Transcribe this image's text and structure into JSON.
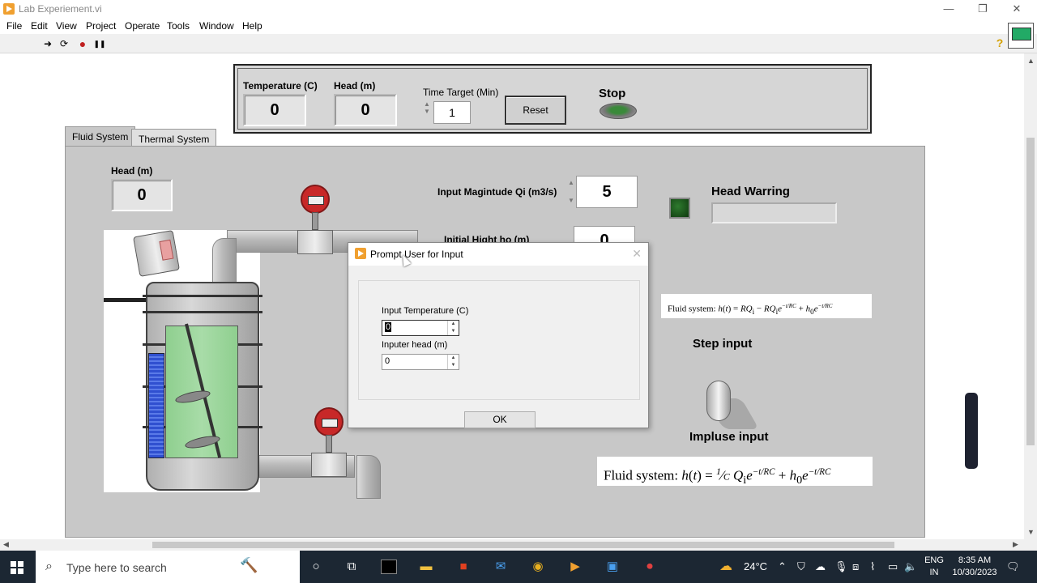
{
  "window": {
    "title": "Lab Experiement.vi",
    "controls": {
      "minimize": "—",
      "restore": "❐",
      "close": "✕"
    }
  },
  "menu": [
    "File",
    "Edit",
    "View",
    "Project",
    "Operate",
    "Tools",
    "Window",
    "Help"
  ],
  "toolbar": {
    "run": "➜",
    "run_continuous": "⟳",
    "abort": "●",
    "pause": "❚❚",
    "help": "?"
  },
  "controls": {
    "temperature_label": "Temperature (C)",
    "temperature_value": "0",
    "head_label": "Head (m)",
    "head_value": "0",
    "time_target_label": "Time Target (Min)",
    "time_target_value": "1",
    "reset_label": "Reset",
    "stop_label": "Stop"
  },
  "tabs": [
    {
      "label": "Fluid System",
      "active": true
    },
    {
      "label": "Thermal System",
      "active": false
    }
  ],
  "fluid": {
    "head_label": "Head (m)",
    "head_value": "0",
    "input_magnitude_label": "Input Magintude Qi (m3/s)",
    "input_magnitude_value": "5",
    "initial_height_label": "Initial Hight ho (m)",
    "initial_height_value": "0",
    "head_warning_label": "Head Warring",
    "head_warning_value": "",
    "step_input_label": "Step input",
    "impulse_input_label": "Impluse input",
    "formula_step_prefix": "Fluid system:",
    "formula_impulse_prefix": "Fluid system:"
  },
  "dialog": {
    "title": "Prompt User for Input",
    "close": "✕",
    "field1_label": "Input Temperature (C)",
    "field1_value": "0",
    "field2_label": "Inputer head (m)",
    "field2_value": "0",
    "ok_label": "OK"
  },
  "taskbar": {
    "search_placeholder": "Type here to search",
    "weather": "24°C",
    "lang_line1": "ENG",
    "lang_line2": "IN",
    "time": "8:35 AM",
    "date": "10/30/2023"
  },
  "colors": {
    "accent_orange": "#f0a030",
    "panel_gray": "#c8c8c8",
    "taskbar": "#1c2733",
    "meter_red": "#c82828",
    "led_green": "#2e7a2e"
  }
}
